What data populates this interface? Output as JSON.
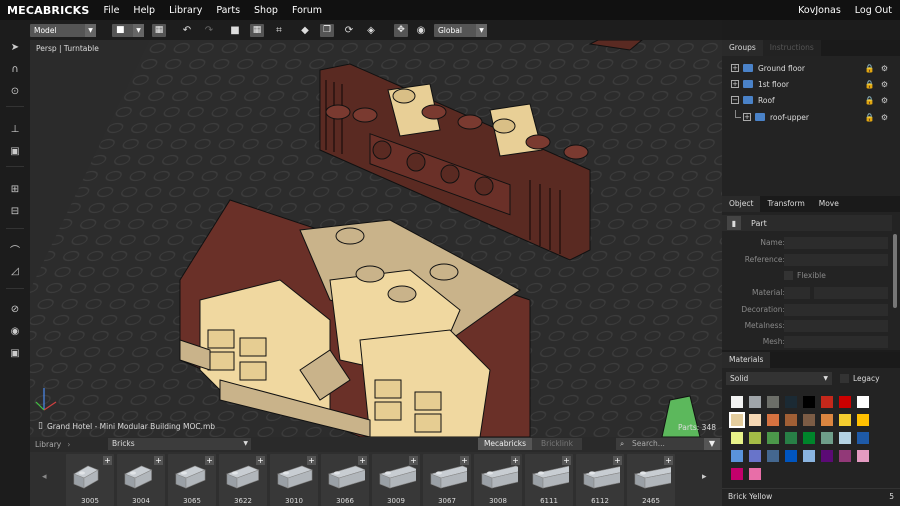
{
  "app": {
    "logo": "MECABRICKS"
  },
  "menu": [
    {
      "label": "File"
    },
    {
      "label": "Help"
    },
    {
      "label": "Library"
    },
    {
      "label": "Parts"
    },
    {
      "label": "Shop"
    },
    {
      "label": "Forum"
    }
  ],
  "user": {
    "name": "KovJonas",
    "logout": "Log Out"
  },
  "toolbar": {
    "mode_select": "Model",
    "space_select": "Global"
  },
  "viewport": {
    "label": "Persp | Turntable",
    "file": "Grand Hotel - Mini Modular Building MOC.mb",
    "parts": "Parts: 348"
  },
  "groups": {
    "tabs": [
      {
        "label": "Groups"
      },
      {
        "label": "Instructions"
      }
    ],
    "items": [
      {
        "label": "Ground floor"
      },
      {
        "label": "1st floor"
      },
      {
        "label": "Roof"
      },
      {
        "label": "roof-upper"
      }
    ]
  },
  "object": {
    "tabs": [
      {
        "label": "Object"
      },
      {
        "label": "Transform"
      },
      {
        "label": "Move"
      }
    ],
    "header": "Part",
    "fields": [
      {
        "label": "Name:"
      },
      {
        "label": "Reference:"
      },
      {
        "label": "Flexible"
      },
      {
        "label": "Material:"
      },
      {
        "label": "Decoration:"
      },
      {
        "label": "Metalness:"
      },
      {
        "label": "Mesh:"
      }
    ]
  },
  "materials": {
    "title": "Materials",
    "type_select": "Solid",
    "legacy": "Legacy",
    "selected_name": "Brick Yellow",
    "selected_count": "5",
    "colors": [
      "#f2f3f2",
      "#a0a5a9",
      "#6c6e68",
      "#1b2a34",
      "#000000",
      "#c4281b",
      "#cc0000",
      "#ffffff",
      "#e4cd9e",
      "#f6d7b3",
      "#d67240",
      "#a05f35",
      "#7c5c45",
      "#da8540",
      "#f5cd2f",
      "#ffc000",
      "#e8f38a",
      "#a4bd46",
      "#4b974a",
      "#287f46",
      "#00852b",
      "#6e9e8a",
      "#b4d2e3",
      "#1e5aa8",
      "#5a93db",
      "#6874ca",
      "#44678f",
      "#0055bf",
      "#8ab4e0",
      "#5b0a75",
      "#923978",
      "#e49bc1",
      "#c4006c",
      "#e86ea8"
    ]
  },
  "library": {
    "label": "Library",
    "category": "Bricks",
    "source_a": "Mecabricks",
    "source_b": "Bricklink",
    "search_placeholder": "Search...",
    "parts": [
      {
        "id": "3005"
      },
      {
        "id": "3004"
      },
      {
        "id": "3065"
      },
      {
        "id": "3622"
      },
      {
        "id": "3010"
      },
      {
        "id": "3066"
      },
      {
        "id": "3009"
      },
      {
        "id": "3067"
      },
      {
        "id": "3008"
      },
      {
        "id": "6111"
      },
      {
        "id": "6112"
      },
      {
        "id": "2465"
      }
    ]
  }
}
